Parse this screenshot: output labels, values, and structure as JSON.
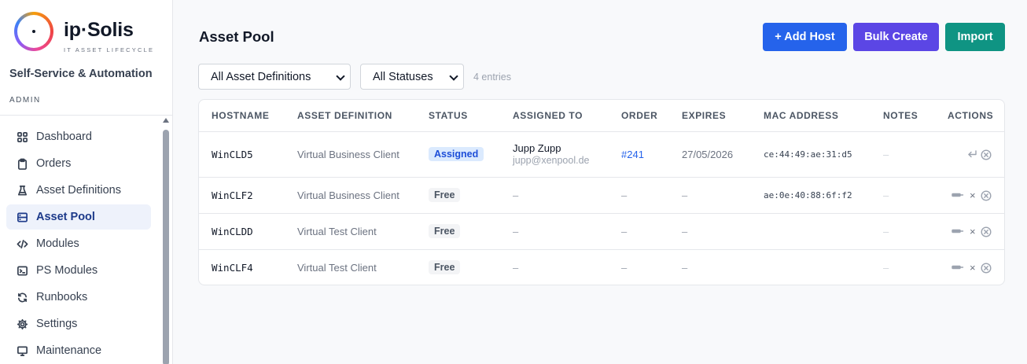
{
  "brand": {
    "name": "ip·Solis",
    "tagline": "IT ASSET LIFECYCLE",
    "subtitle": "Self-Service & Automation",
    "role": "ADMIN"
  },
  "nav": [
    {
      "label": "Dashboard",
      "icon": "grid-icon",
      "active": false
    },
    {
      "label": "Orders",
      "icon": "clipboard-icon",
      "active": false
    },
    {
      "label": "Asset Definitions",
      "icon": "flask-icon",
      "active": false
    },
    {
      "label": "Asset Pool",
      "icon": "server-icon",
      "active": true
    },
    {
      "label": "Modules",
      "icon": "code-icon",
      "active": false
    },
    {
      "label": "PS Modules",
      "icon": "terminal-icon",
      "active": false
    },
    {
      "label": "Runbooks",
      "icon": "refresh-icon",
      "active": false
    },
    {
      "label": "Settings",
      "icon": "gear-icon",
      "active": false
    },
    {
      "label": "Maintenance",
      "icon": "monitor-icon",
      "active": false
    }
  ],
  "page": {
    "title": "Asset Pool"
  },
  "toolbar": {
    "add_label": "+ Add Host",
    "bulk_label": "Bulk Create",
    "import_label": "Import"
  },
  "filters": {
    "definition": "All Asset Definitions",
    "status": "All Statuses",
    "entries": "4 entries"
  },
  "table": {
    "columns": [
      "HOSTNAME",
      "ASSET DEFINITION",
      "STATUS",
      "ASSIGNED TO",
      "ORDER",
      "EXPIRES",
      "MAC ADDRESS",
      "NOTES",
      "ACTIONS"
    ],
    "rows": [
      {
        "hostname": "WinCLD5",
        "definition": "Virtual Business Client",
        "status": "Assigned",
        "assigned_name": "Jupp Zupp",
        "assigned_email": "jupp@xenpool.de",
        "order": "#241",
        "expires": "27/05/2026",
        "mac": "ce:44:49:ae:31:d5",
        "notes": "–"
      },
      {
        "hostname": "WinCLF2",
        "definition": "Virtual Business Client",
        "status": "Free",
        "assigned": "–",
        "order": "–",
        "expires": "–",
        "mac": "ae:0e:40:88:6f:f2",
        "notes": "–"
      },
      {
        "hostname": "WinCLDD",
        "definition": "Virtual Test Client",
        "status": "Free",
        "assigned": "–",
        "order": "–",
        "expires": "–",
        "mac": "",
        "notes": "–"
      },
      {
        "hostname": "WinCLF4",
        "definition": "Virtual Test Client",
        "status": "Free",
        "assigned": "–",
        "order": "–",
        "expires": "–",
        "mac": "",
        "notes": "–"
      }
    ]
  },
  "actions": {
    "delete_glyph": "×"
  },
  "colors": {
    "primary": "#2563eb",
    "bulk": "#5b46e5",
    "import": "#0f9483",
    "active_nav_bg": "#eef2fb"
  }
}
